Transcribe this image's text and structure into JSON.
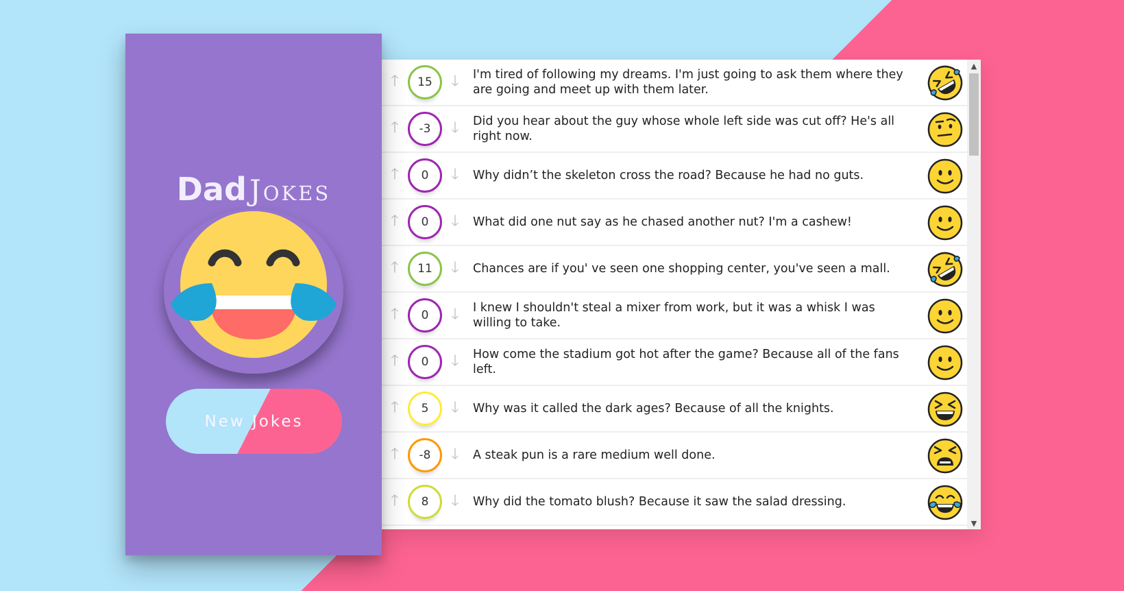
{
  "app": {
    "title_bold": "Dad",
    "title_light": "Jokes",
    "new_jokes_label": "New Jokes"
  },
  "colors": {
    "sidebar": "#9575cd",
    "background_blue": "#b2e4fa",
    "background_pink": "#fd6392"
  },
  "icons": {
    "upvote": "arrow-up-icon",
    "downvote": "arrow-down-icon"
  },
  "jokes": [
    {
      "votes": "15",
      "text": "I'm tired of following my dreams. I'm just going to ask them where they are going and meet up with them later.",
      "color": "#8bc34a",
      "emoji": "rofl"
    },
    {
      "votes": "-3",
      "text": "Did you hear about the guy whose whole left side was cut off? He's all right now.",
      "color": "#9c27b0",
      "emoji": "raised-eyebrow"
    },
    {
      "votes": "0",
      "text": "Why didn’t the skeleton cross the road? Because he had no guts.",
      "color": "#9c27b0",
      "emoji": "slight-smile"
    },
    {
      "votes": "0",
      "text": "What did one nut say as he chased another nut? I'm a cashew!",
      "color": "#9c27b0",
      "emoji": "slight-smile"
    },
    {
      "votes": "11",
      "text": "Chances are if you' ve seen one shopping center, you've seen a mall.",
      "color": "#8bc34a",
      "emoji": "rofl"
    },
    {
      "votes": "0",
      "text": "I knew I shouldn't steal a mixer from work, but it was a whisk I was willing to take.",
      "color": "#9c27b0",
      "emoji": "slight-smile"
    },
    {
      "votes": "0",
      "text": "How come the stadium got hot after the game? Because all of the fans left.",
      "color": "#9c27b0",
      "emoji": "slight-smile"
    },
    {
      "votes": "5",
      "text": "Why was it called the dark ages? Because of all the knights.",
      "color": "#ffeb3b",
      "emoji": "squint-laugh"
    },
    {
      "votes": "-8",
      "text": "A steak pun is a rare medium well done.",
      "color": "#ff9800",
      "emoji": "tired"
    },
    {
      "votes": "8",
      "text": "Why did the tomato blush? Because it saw the salad dressing.",
      "color": "#cddc39",
      "emoji": "tears-of-joy"
    }
  ]
}
